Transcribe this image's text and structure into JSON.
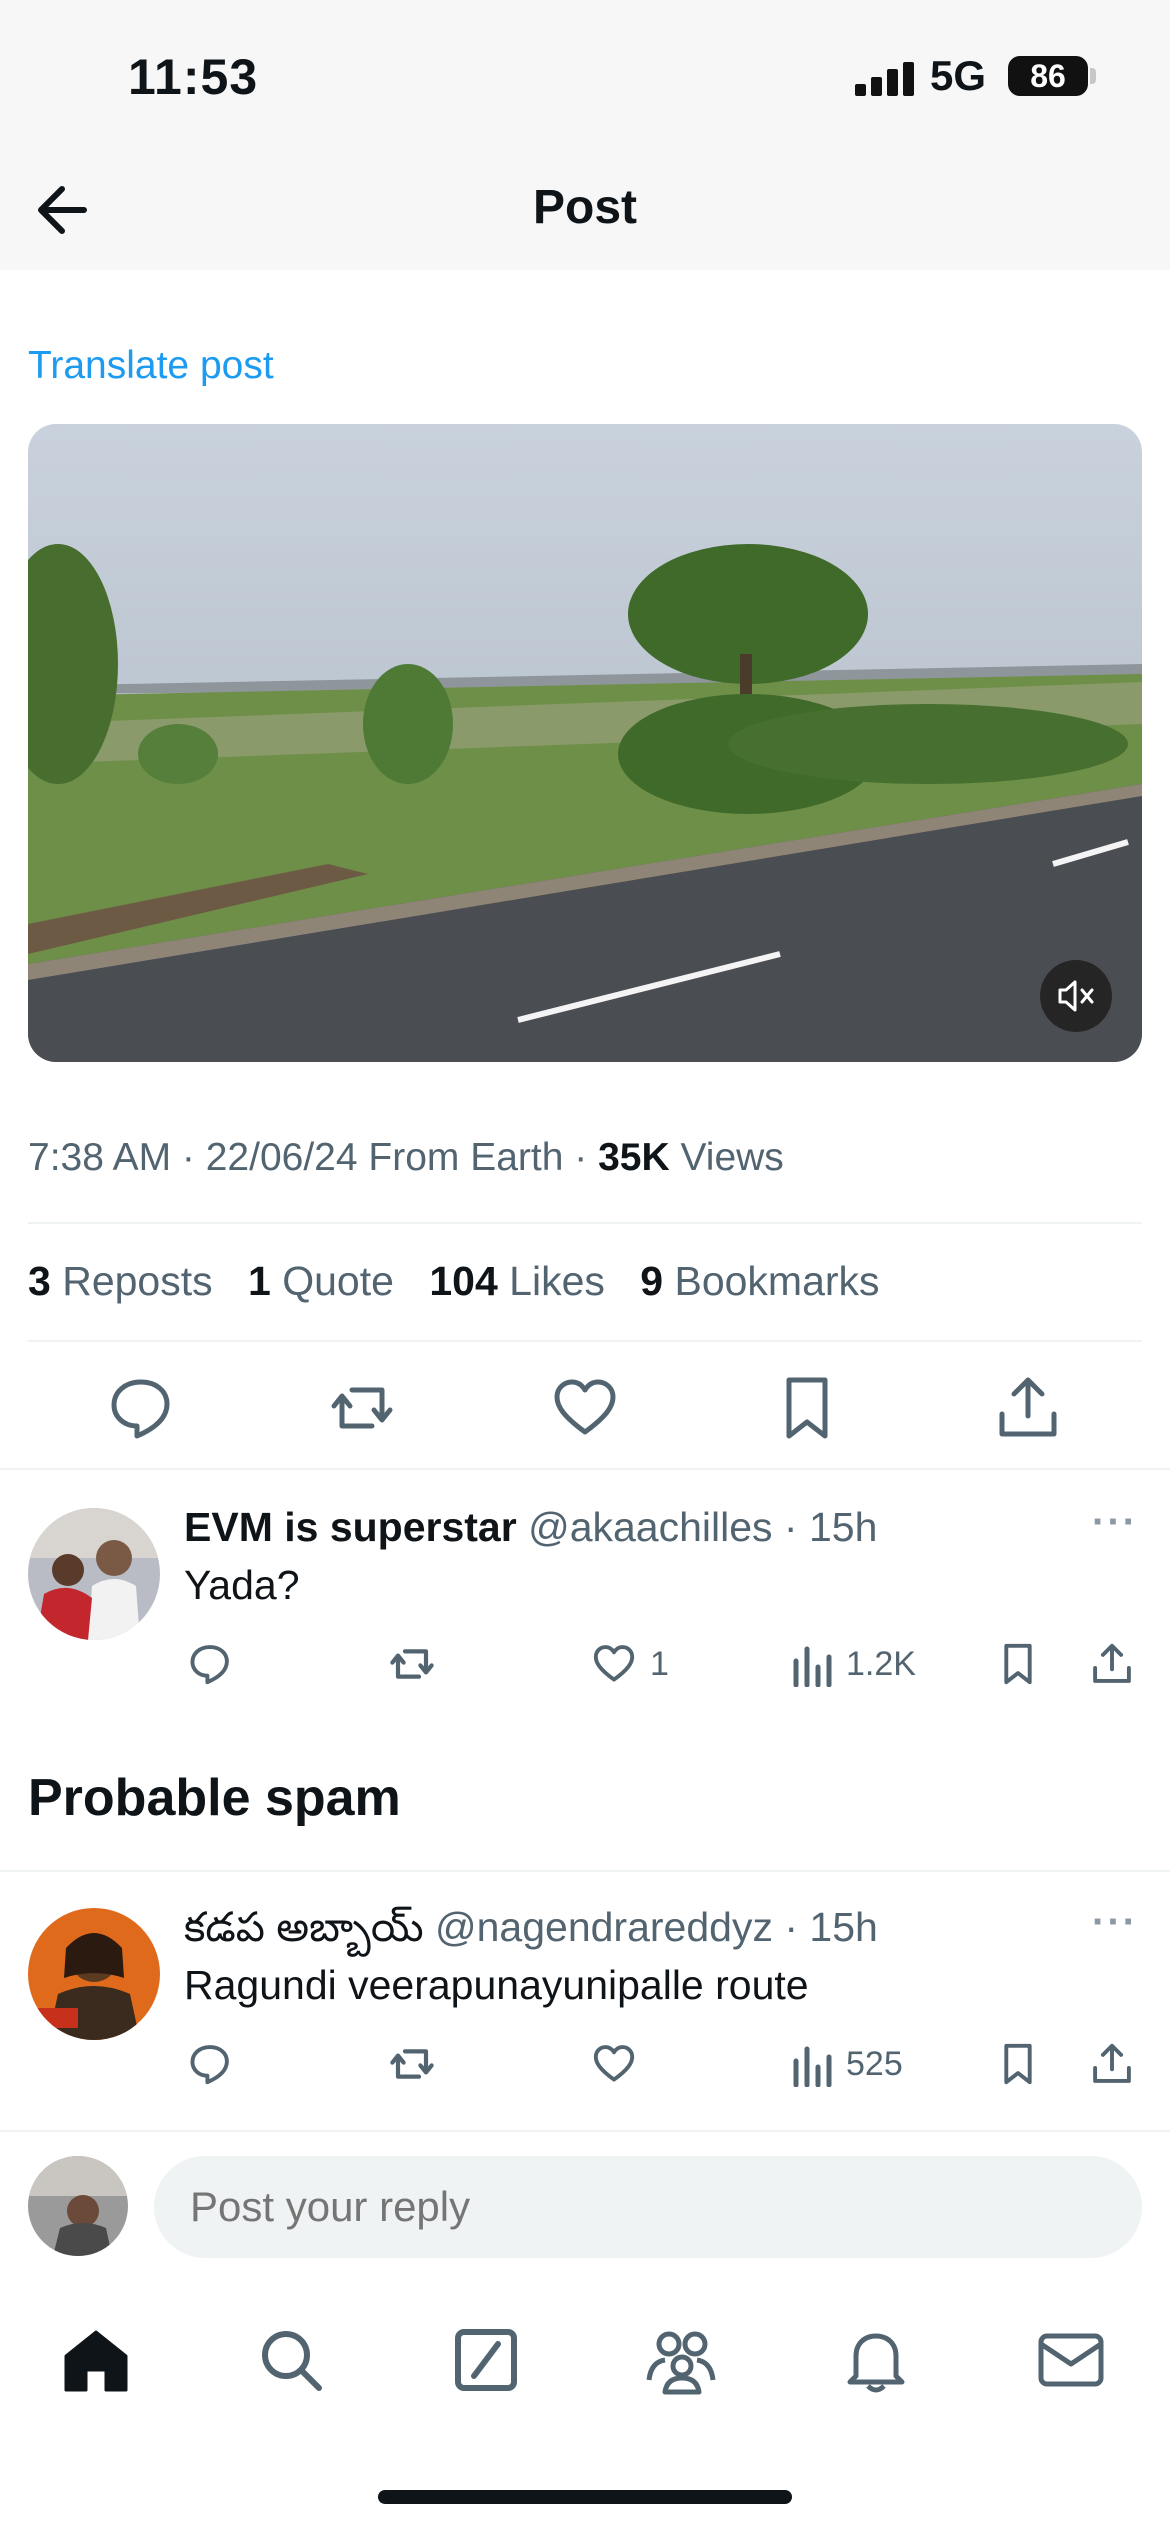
{
  "status_bar": {
    "time": "11:53",
    "network": "5G",
    "battery": "86"
  },
  "header": {
    "title": "Post"
  },
  "post": {
    "translate_label": "Translate post",
    "timestamp": "7:38 AM · 22/06/24 From Earth · ",
    "views_count": "35K",
    "views_label": " Views",
    "stats": {
      "reposts_count": "3",
      "reposts_label": " Reposts",
      "quotes_count": "1",
      "quotes_label": " Quote",
      "likes_count": "104",
      "likes_label": " Likes",
      "bookmarks_count": "9",
      "bookmarks_label": " Bookmarks"
    }
  },
  "replies": [
    {
      "name": "EVM is superstar",
      "handle": " @akaachilles · 15h",
      "text": "Yada?",
      "likes": "1",
      "views": "1.2K"
    },
    {
      "name": "కడప అబ్బాయ్",
      "handle": " @nagendrareddyz · 15h",
      "text": "Ragundi veerapunayunipalle route",
      "likes": "",
      "views": "525"
    }
  ],
  "spam_section": {
    "title": "Probable spam"
  },
  "reply_bar": {
    "placeholder": "Post your reply"
  },
  "more_glyph": "···",
  "colors": {
    "accent": "#1d9bf0",
    "text": "#0f1419",
    "secondary": "#536471",
    "divider": "#eff3f4"
  }
}
